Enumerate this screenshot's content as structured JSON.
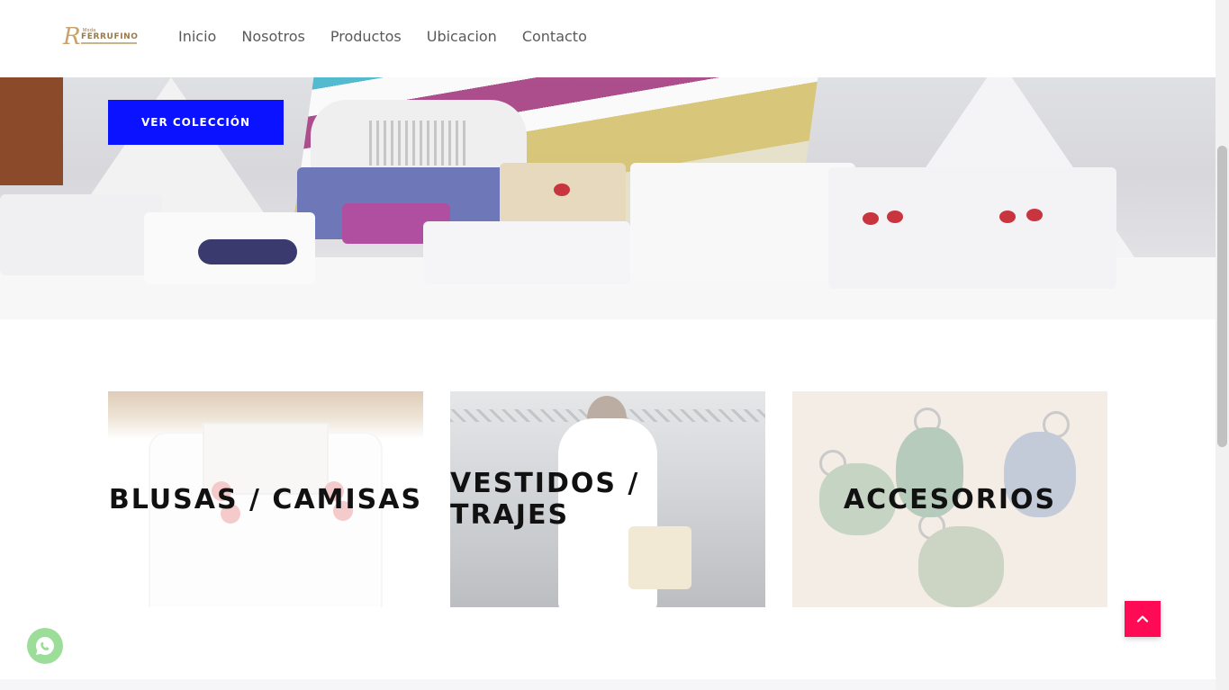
{
  "header": {
    "logo": {
      "letter": "R",
      "name": "FERRUFINO",
      "small": "Moda"
    },
    "nav": [
      {
        "label": "Inicio"
      },
      {
        "label": "Nosotros"
      },
      {
        "label": "Productos"
      },
      {
        "label": "Ubicacion"
      },
      {
        "label": "Contacto"
      }
    ]
  },
  "hero": {
    "cta_label": "VER COLECCIÓN"
  },
  "categories": [
    {
      "label": "BLUSAS / CAMISAS"
    },
    {
      "label": "VESTIDOS / TRAJES"
    },
    {
      "label": "ACCESORIOS"
    }
  ],
  "floating": {
    "whatsapp_icon": "whatsapp-icon",
    "back_to_top_icon": "chevron-up-icon"
  },
  "colors": {
    "cta": "#0a12ff",
    "back_to_top": "#ff0b55",
    "whatsapp": "#4dc247"
  }
}
